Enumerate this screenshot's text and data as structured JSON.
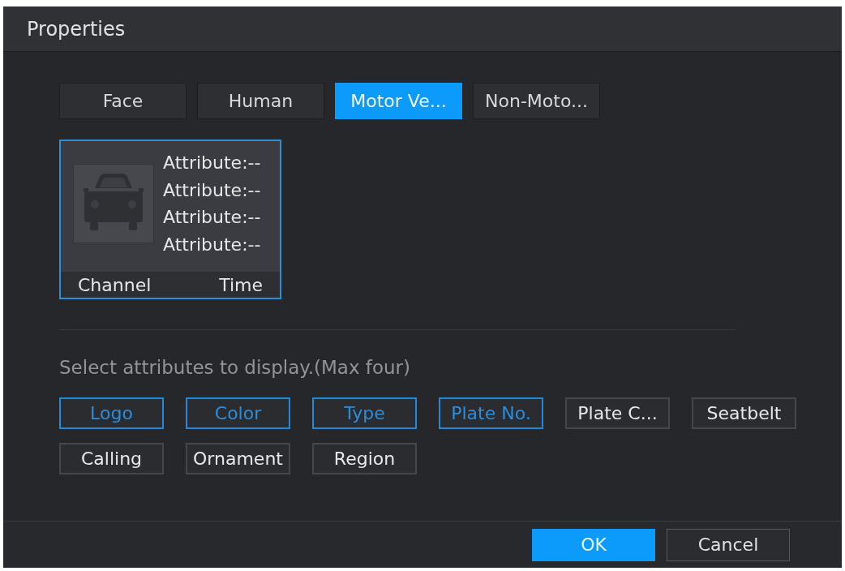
{
  "dialog": {
    "title": "Properties"
  },
  "tabs": [
    {
      "label": "Face",
      "selected": false
    },
    {
      "label": "Human",
      "selected": false
    },
    {
      "label": "Motor Ve...",
      "selected": true
    },
    {
      "label": "Non-Moto...",
      "selected": false
    }
  ],
  "preview_card": {
    "attributes": [
      "Attribute:--",
      "Attribute:--",
      "Attribute:--",
      "Attribute:--"
    ],
    "channel": "Channel",
    "time": "Time"
  },
  "hint": "Select attributes to display.(Max four)",
  "attributes": [
    {
      "label": "Logo",
      "selected": true
    },
    {
      "label": "Color",
      "selected": true
    },
    {
      "label": "Type",
      "selected": true
    },
    {
      "label": "Plate No.",
      "selected": true
    },
    {
      "label": "Plate C...",
      "selected": false
    },
    {
      "label": "Seatbelt",
      "selected": false
    },
    {
      "label": "Calling",
      "selected": false
    },
    {
      "label": "Ornament",
      "selected": false
    },
    {
      "label": "Region",
      "selected": false
    }
  ],
  "buttons": [
    {
      "label": "OK",
      "kind": "primary"
    },
    {
      "label": "Cancel",
      "kind": "secondary"
    }
  ]
}
